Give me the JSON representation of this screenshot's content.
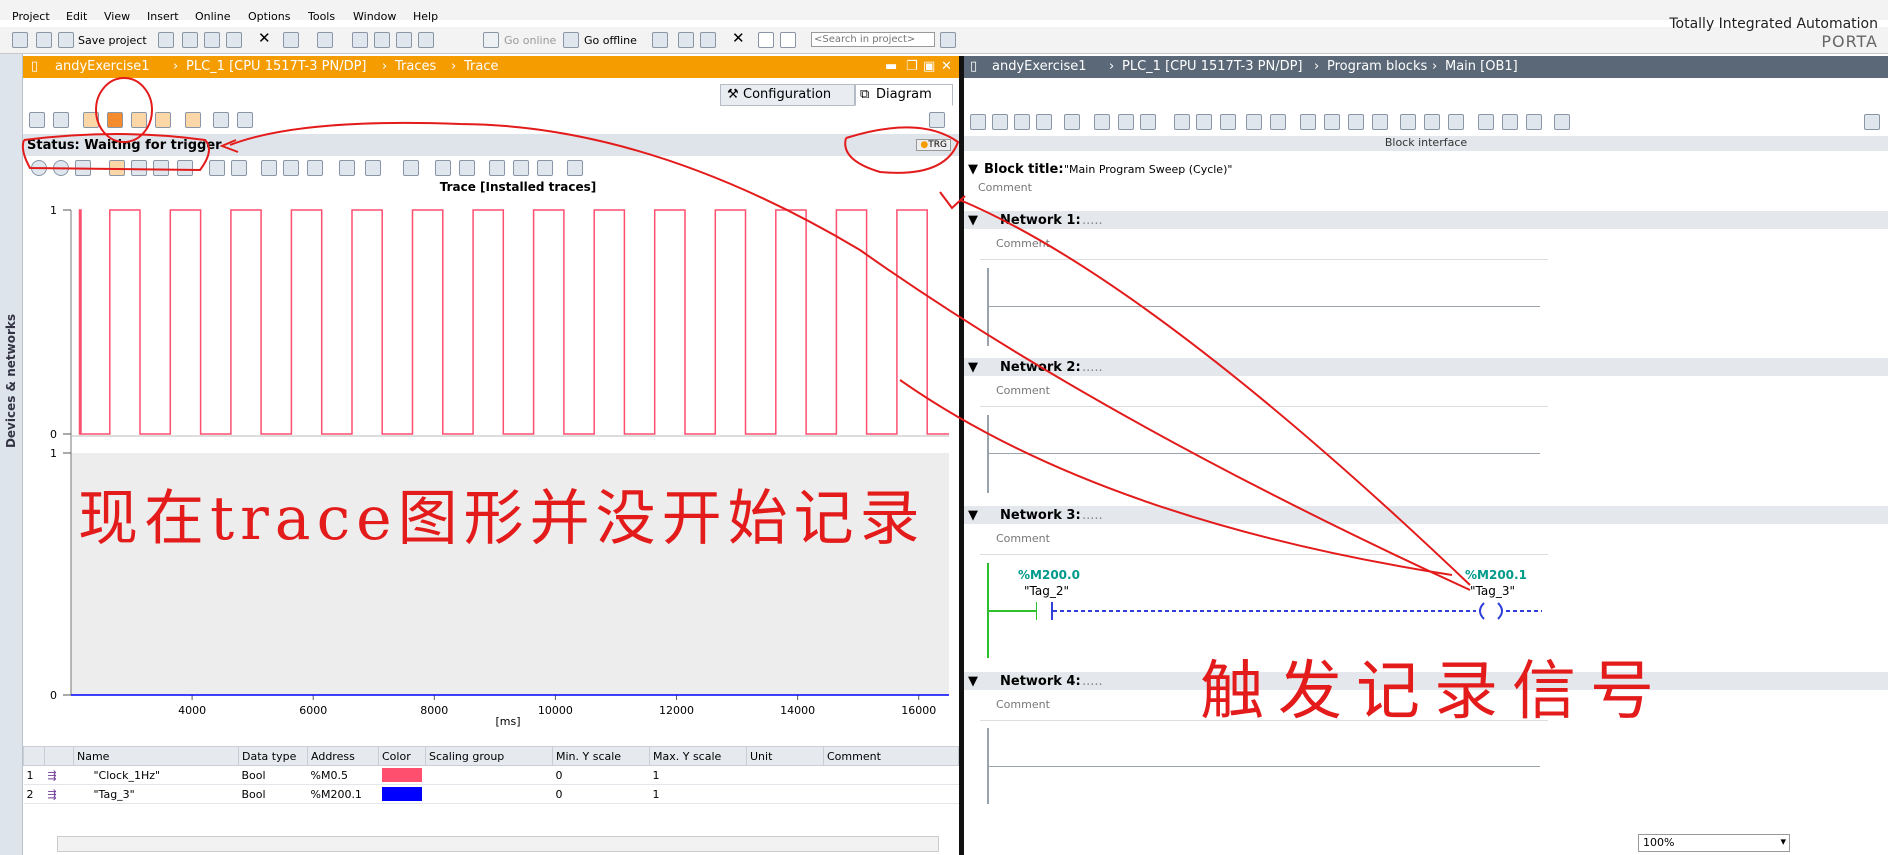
{
  "menu": {
    "items": [
      "Project",
      "Edit",
      "View",
      "Insert",
      "Online",
      "Options",
      "Tools",
      "Window",
      "Help"
    ]
  },
  "toolbar": {
    "save_label": "Save project",
    "go_online_label": "Go online",
    "go_offline_label": "Go offline",
    "search_placeholder": "<Search in project>"
  },
  "brand": {
    "line1": "Totally Integrated Automation",
    "line2": "PORTA"
  },
  "left_strip": {
    "label": "Devices & networks"
  },
  "left_panel": {
    "breadcrumb": [
      "andyExercise1",
      "PLC_1 [CPU 1517T-3 PN/DP]",
      "Traces",
      "Trace"
    ],
    "tabs": [
      "Configuration",
      "Diagram"
    ],
    "active_tab": "Diagram",
    "status": "Status: Waiting for trigger",
    "trigger_badge": "TRG",
    "chart_title": "Trace [Installed traces]"
  },
  "chart_data": {
    "type": "line",
    "x_axis": {
      "label": "[ms]",
      "ticks": [
        4000,
        6000,
        8000,
        10000,
        12000,
        14000,
        16000
      ],
      "range": [
        2000,
        16500
      ]
    },
    "top_axis": {
      "ticks": [
        0,
        1
      ]
    },
    "bottom_axis": {
      "ticks": [
        0,
        1
      ]
    },
    "series": [
      {
        "name": "\"Clock_1Hz\"",
        "color": "#ff4f6f",
        "kind": "square",
        "period_ms": 1000,
        "high": 1,
        "low": 0
      },
      {
        "name": "\"Tag_3\"",
        "color": "#0000ff",
        "kind": "constant",
        "value": 0
      }
    ]
  },
  "signal_table": {
    "columns": [
      "Name",
      "Data type",
      "Address",
      "Color",
      "Scaling group",
      "Min. Y scale",
      "Max. Y scale",
      "Unit",
      "Comment"
    ],
    "rows": [
      {
        "index": "1",
        "name": "\"Clock_1Hz\"",
        "type": "Bool",
        "address": "%M0.5",
        "color": "#ff4f6f",
        "min": "0",
        "max": "1"
      },
      {
        "index": "2",
        "name": "\"Tag_3\"",
        "type": "Bool",
        "address": "%M200.1",
        "color": "#0000ff",
        "min": "0",
        "max": "1"
      }
    ]
  },
  "right_panel": {
    "breadcrumb": [
      "andyExercise1",
      "PLC_1 [CPU 1517T-3 PN/DP]",
      "Program blocks",
      "Main [OB1]"
    ],
    "block_interface_label": "Block interface",
    "block_title_label": "Block title:",
    "block_title_value": "\"Main Program Sweep (Cycle)\"",
    "comment_label": "Comment",
    "networks": [
      "Network 1:",
      "Network 2:",
      "Network 3:",
      "Network 4:"
    ],
    "network_dots": ".....",
    "contact": {
      "address": "%M200.0",
      "name": "\"Tag_2\""
    },
    "coil": {
      "address": "%M200.1",
      "name": "\"Tag_3\""
    },
    "zoom": "100%"
  },
  "annotations": {
    "left_note": "现在trace图形并没开始记录",
    "right_note": "触发记录信号"
  }
}
